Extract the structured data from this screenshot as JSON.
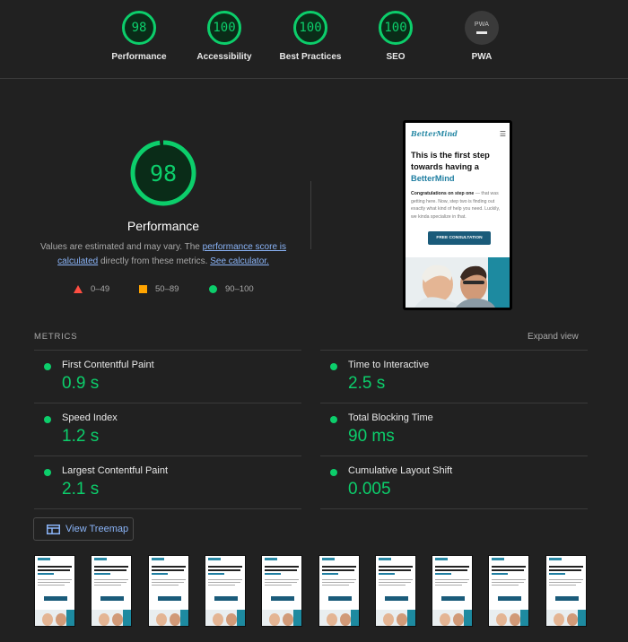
{
  "top_scores": [
    {
      "label": "Performance",
      "score": "98"
    },
    {
      "label": "Accessibility",
      "score": "100"
    },
    {
      "label": "Best Practices",
      "score": "100"
    },
    {
      "label": "SEO",
      "score": "100"
    },
    {
      "label": "PWA",
      "score": "",
      "badge_text": "PWA"
    }
  ],
  "summary": {
    "score": "98",
    "score_fraction": 0.98,
    "title": "Performance",
    "desc_prefix": "Values are estimated and may vary. The ",
    "desc_link1": "performance score is calculated",
    "desc_middle": " directly from these metrics. ",
    "desc_link2": "See calculator.",
    "legend": [
      {
        "shape": "triangle",
        "range": "0–49",
        "color": "#ff4e42"
      },
      {
        "shape": "square",
        "range": "50–89",
        "color": "#ffa400"
      },
      {
        "shape": "circle",
        "range": "90–100",
        "color": "#0cce6b"
      }
    ]
  },
  "screenshot_preview": {
    "logo": "BetterMind",
    "headline_1": "This is the first step towards having a",
    "headline_brand": "BetterMind",
    "body_bold": "Congratulations on step one",
    "body_rest": "— that was getting here. Now, step two is finding out exactly what kind of help you need. Luckily, we kinda specialize in that.",
    "cta": "FREE CONSULTATION"
  },
  "metrics": {
    "heading": "METRICS",
    "expand_label": "Expand view",
    "items": [
      {
        "name": "First Contentful Paint",
        "value": "0.9 s"
      },
      {
        "name": "Time to Interactive",
        "value": "2.5 s"
      },
      {
        "name": "Speed Index",
        "value": "1.2 s"
      },
      {
        "name": "Total Blocking Time",
        "value": "90 ms"
      },
      {
        "name": "Largest Contentful Paint",
        "value": "2.1 s"
      },
      {
        "name": "Cumulative Layout Shift",
        "value": "0.005"
      }
    ]
  },
  "treemap_button": {
    "label": "View Treemap",
    "icon": "treemap-icon"
  },
  "colors": {
    "pass": "#0cce6b",
    "average": "#ffa400",
    "fail": "#ff4e42",
    "link": "#8ab4f8",
    "background": "#212121"
  }
}
